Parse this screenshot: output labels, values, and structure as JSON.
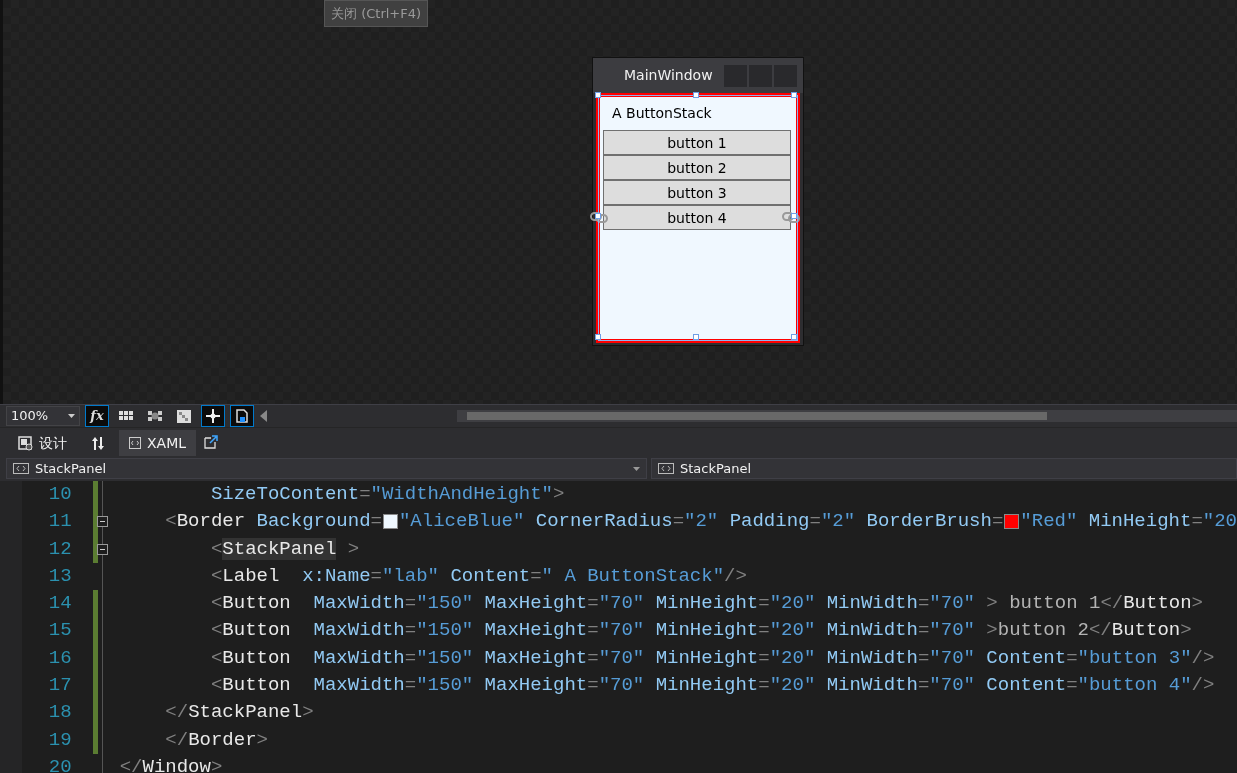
{
  "tooltip": {
    "text": "关闭 (Ctrl+F4)"
  },
  "preview_window": {
    "title": "MainWindow",
    "label": "A ButtonStack",
    "buttons": [
      {
        "label": "button 1",
        "anchored": false
      },
      {
        "label": "button 2",
        "anchored": false
      },
      {
        "label": "button 3",
        "anchored": false
      },
      {
        "label": "button 4",
        "anchored": true
      }
    ]
  },
  "toolbar": {
    "zoom": "100%",
    "tools": [
      {
        "kind": "formula",
        "label": "fx",
        "selected": true
      },
      {
        "kind": "grid",
        "selected": false
      },
      {
        "kind": "snap-grid",
        "selected": false
      },
      {
        "kind": "checker",
        "selected": false
      },
      {
        "kind": "snap-lines",
        "selected": true
      },
      {
        "kind": "document",
        "selected": true
      }
    ]
  },
  "tabs": [
    {
      "label": "设计",
      "selected": false
    },
    {
      "label": "XAML",
      "selected": true
    }
  ],
  "breadcrumbs": [
    "StackPanel",
    "StackPanel"
  ],
  "code": [
    {
      "number": "10",
      "changed": true,
      "foldable": false,
      "tokens": [
        {
          "text": "        SizeToContent",
          "kind": "attr"
        },
        {
          "text": "=",
          "kind": "punct"
        },
        {
          "text": "\"WidthAndHeight\"",
          "kind": "value"
        },
        {
          "text": ">",
          "kind": "punct"
        }
      ]
    },
    {
      "number": "11",
      "changed": true,
      "foldable": true,
      "tokens": [
        {
          "text": "    <",
          "kind": "punct"
        },
        {
          "text": "Border",
          "kind": "tag"
        },
        {
          "text": " Background",
          "kind": "attr"
        },
        {
          "text": "=",
          "kind": "punct"
        },
        {
          "kind": "swatch",
          "color": "#f0f8ff"
        },
        {
          "text": "\"AliceBlue\"",
          "kind": "value"
        },
        {
          "text": " CornerRadius",
          "kind": "attr"
        },
        {
          "text": "=",
          "kind": "punct"
        },
        {
          "text": "\"2\"",
          "kind": "value"
        },
        {
          "text": " Padding",
          "kind": "attr"
        },
        {
          "text": "=",
          "kind": "punct"
        },
        {
          "text": "\"2\"",
          "kind": "value"
        },
        {
          "text": " BorderBrush",
          "kind": "attr"
        },
        {
          "text": "=",
          "kind": "punct"
        },
        {
          "kind": "swatch",
          "color": "#ff0000"
        },
        {
          "text": "\"Red\"",
          "kind": "value"
        },
        {
          "text": " MinHeight",
          "kind": "attr"
        },
        {
          "text": "=",
          "kind": "punct"
        },
        {
          "text": "\"20",
          "kind": "value"
        }
      ]
    },
    {
      "number": "12",
      "changed": true,
      "foldable": true,
      "tokens": [
        {
          "text": "        <",
          "kind": "punct"
        },
        {
          "text": "StackPanel",
          "kind": "tag",
          "highlighted": true
        },
        {
          "text": " >",
          "kind": "punct"
        }
      ]
    },
    {
      "number": "13",
      "changed": false,
      "foldable": false,
      "tokens": [
        {
          "text": "        <",
          "kind": "punct"
        },
        {
          "text": "Label",
          "kind": "tag"
        },
        {
          "text": "  x:Name",
          "kind": "attr"
        },
        {
          "text": "=",
          "kind": "punct"
        },
        {
          "text": "\"lab\"",
          "kind": "value"
        },
        {
          "text": " Content",
          "kind": "attr"
        },
        {
          "text": "=",
          "kind": "punct"
        },
        {
          "text": "\" A ButtonStack\"",
          "kind": "value"
        },
        {
          "text": "/>",
          "kind": "punct"
        }
      ]
    },
    {
      "number": "14",
      "changed": true,
      "foldable": false,
      "tokens": [
        {
          "text": "        <",
          "kind": "punct"
        },
        {
          "text": "Button",
          "kind": "tag"
        },
        {
          "text": "  MaxWidth",
          "kind": "attr"
        },
        {
          "text": "=",
          "kind": "punct"
        },
        {
          "text": "\"150\"",
          "kind": "value"
        },
        {
          "text": " MaxHeight",
          "kind": "attr"
        },
        {
          "text": "=",
          "kind": "punct"
        },
        {
          "text": "\"70\"",
          "kind": "value"
        },
        {
          "text": " MinHeight",
          "kind": "attr"
        },
        {
          "text": "=",
          "kind": "punct"
        },
        {
          "text": "\"20\"",
          "kind": "value"
        },
        {
          "text": " MinWidth",
          "kind": "attr"
        },
        {
          "text": "=",
          "kind": "punct"
        },
        {
          "text": "\"70\"",
          "kind": "value"
        },
        {
          "text": " >",
          "kind": "punct"
        },
        {
          "text": " button 1",
          "kind": "text"
        },
        {
          "text": "</",
          "kind": "punct"
        },
        {
          "text": "Button",
          "kind": "tag"
        },
        {
          "text": ">",
          "kind": "punct"
        }
      ]
    },
    {
      "number": "15",
      "changed": true,
      "foldable": false,
      "tokens": [
        {
          "text": "        <",
          "kind": "punct"
        },
        {
          "text": "Button",
          "kind": "tag"
        },
        {
          "text": "  MaxWidth",
          "kind": "attr"
        },
        {
          "text": "=",
          "kind": "punct"
        },
        {
          "text": "\"150\"",
          "kind": "value"
        },
        {
          "text": " MaxHeight",
          "kind": "attr"
        },
        {
          "text": "=",
          "kind": "punct"
        },
        {
          "text": "\"70\"",
          "kind": "value"
        },
        {
          "text": " MinHeight",
          "kind": "attr"
        },
        {
          "text": "=",
          "kind": "punct"
        },
        {
          "text": "\"20\"",
          "kind": "value"
        },
        {
          "text": " MinWidth",
          "kind": "attr"
        },
        {
          "text": "=",
          "kind": "punct"
        },
        {
          "text": "\"70\"",
          "kind": "value"
        },
        {
          "text": " >",
          "kind": "punct"
        },
        {
          "text": "button 2",
          "kind": "text"
        },
        {
          "text": "</",
          "kind": "punct"
        },
        {
          "text": "Button",
          "kind": "tag"
        },
        {
          "text": ">",
          "kind": "punct"
        }
      ]
    },
    {
      "number": "16",
      "changed": true,
      "foldable": false,
      "tokens": [
        {
          "text": "        <",
          "kind": "punct"
        },
        {
          "text": "Button",
          "kind": "tag"
        },
        {
          "text": "  MaxWidth",
          "kind": "attr"
        },
        {
          "text": "=",
          "kind": "punct"
        },
        {
          "text": "\"150\"",
          "kind": "value"
        },
        {
          "text": " MaxHeight",
          "kind": "attr"
        },
        {
          "text": "=",
          "kind": "punct"
        },
        {
          "text": "\"70\"",
          "kind": "value"
        },
        {
          "text": " MinHeight",
          "kind": "attr"
        },
        {
          "text": "=",
          "kind": "punct"
        },
        {
          "text": "\"20\"",
          "kind": "value"
        },
        {
          "text": " MinWidth",
          "kind": "attr"
        },
        {
          "text": "=",
          "kind": "punct"
        },
        {
          "text": "\"70\"",
          "kind": "value"
        },
        {
          "text": " Content",
          "kind": "attr"
        },
        {
          "text": "=",
          "kind": "punct"
        },
        {
          "text": "\"button 3\"",
          "kind": "value"
        },
        {
          "text": "/>",
          "kind": "punct"
        }
      ]
    },
    {
      "number": "17",
      "changed": true,
      "foldable": false,
      "tokens": [
        {
          "text": "        <",
          "kind": "punct"
        },
        {
          "text": "Button",
          "kind": "tag"
        },
        {
          "text": "  MaxWidth",
          "kind": "attr"
        },
        {
          "text": "=",
          "kind": "punct"
        },
        {
          "text": "\"150\"",
          "kind": "value"
        },
        {
          "text": " MaxHeight",
          "kind": "attr"
        },
        {
          "text": "=",
          "kind": "punct"
        },
        {
          "text": "\"70\"",
          "kind": "value"
        },
        {
          "text": " MinHeight",
          "kind": "attr"
        },
        {
          "text": "=",
          "kind": "punct"
        },
        {
          "text": "\"20\"",
          "kind": "value"
        },
        {
          "text": " MinWidth",
          "kind": "attr"
        },
        {
          "text": "=",
          "kind": "punct"
        },
        {
          "text": "\"70\"",
          "kind": "value"
        },
        {
          "text": " Content",
          "kind": "attr"
        },
        {
          "text": "=",
          "kind": "punct"
        },
        {
          "text": "\"button 4\"",
          "kind": "value"
        },
        {
          "text": "/>",
          "kind": "punct"
        }
      ]
    },
    {
      "number": "18",
      "changed": true,
      "foldable": false,
      "tokens": [
        {
          "text": "    </",
          "kind": "punct"
        },
        {
          "text": "StackPanel",
          "kind": "tag"
        },
        {
          "text": ">",
          "kind": "punct"
        }
      ]
    },
    {
      "number": "19",
      "changed": true,
      "foldable": false,
      "tokens": [
        {
          "text": "    </",
          "kind": "punct"
        },
        {
          "text": "Border",
          "kind": "tag"
        },
        {
          "text": ">",
          "kind": "punct"
        }
      ]
    },
    {
      "number": "20",
      "changed": false,
      "foldable": false,
      "tokens": [
        {
          "text": "</",
          "kind": "punct"
        },
        {
          "text": "Window",
          "kind": "tag"
        },
        {
          "text": ">",
          "kind": "punct"
        }
      ]
    }
  ]
}
